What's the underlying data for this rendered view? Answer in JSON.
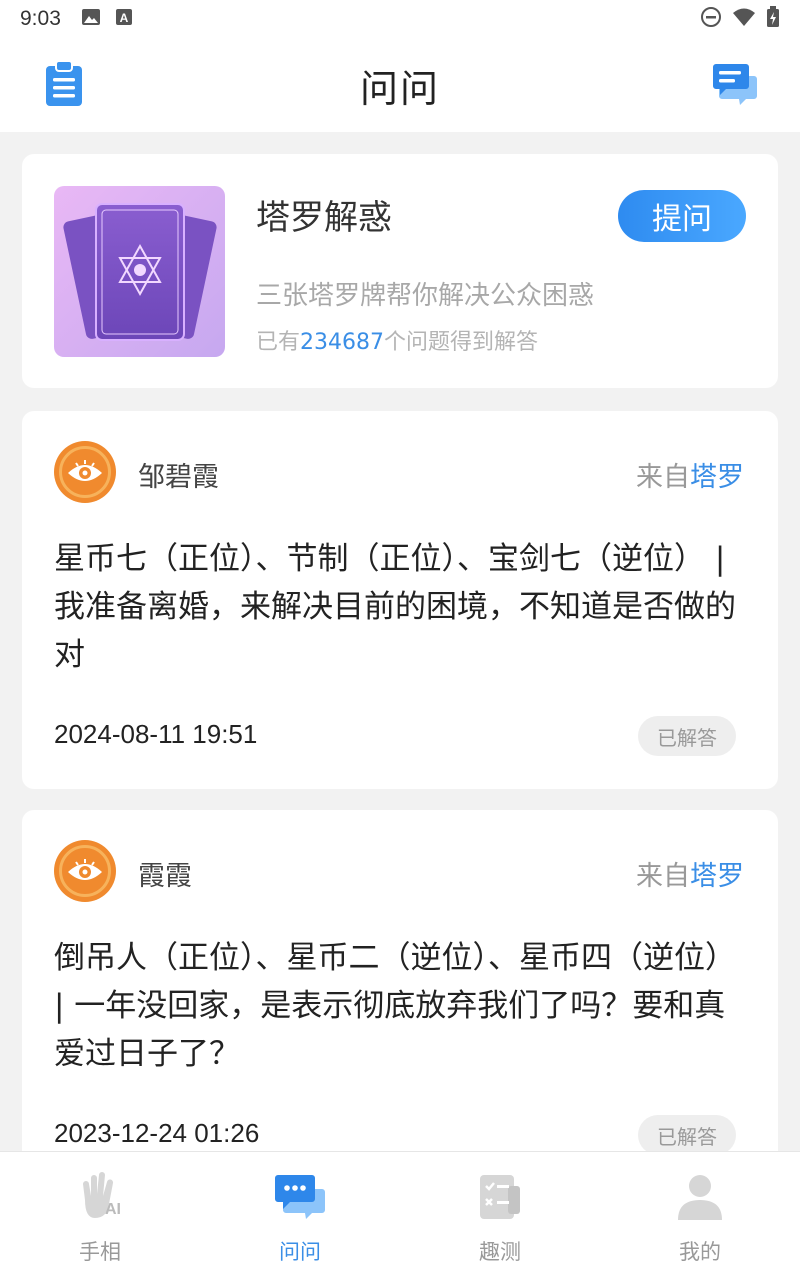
{
  "status_bar": {
    "time": "9:03",
    "left_icons": [
      "image-icon",
      "a-icon"
    ],
    "right_icons": [
      "dnd-icon",
      "wifi-icon",
      "battery-icon"
    ]
  },
  "header": {
    "title": "问问",
    "left_icon": "clipboard-icon",
    "right_icon": "chat-icon"
  },
  "tarot_card": {
    "title": "塔罗解惑",
    "ask_button": "提问",
    "description": "三张塔罗牌帮你解决公众困惑",
    "count_prefix": "已有",
    "count": "234687",
    "count_suffix": "个问题得到解答"
  },
  "questions": [
    {
      "user": "邹碧霞",
      "from_label": "来自",
      "source": "塔罗",
      "text": "星币七（正位）、节制（正位）、宝剑七（逆位） | 我准备离婚，来解决目前的困境，不知道是否做的对",
      "date": "2024-08-11 19:51",
      "status": "已解答"
    },
    {
      "user": "霞霞",
      "from_label": "来自",
      "source": "塔罗",
      "text": "倒吊人（正位）、星币二（逆位）、星币四（逆位） | 一年没回家，是表示彻底放弃我们了吗？要和真爱过日子了？",
      "date": "2023-12-24 01:26",
      "status": "已解答"
    }
  ],
  "tab_bar": {
    "tabs": [
      {
        "label": "手相",
        "icon": "palm-ai-icon"
      },
      {
        "label": "问问",
        "icon": "chat-icon"
      },
      {
        "label": "趣测",
        "icon": "test-sheet-icon"
      },
      {
        "label": "我的",
        "icon": "user-icon"
      }
    ],
    "active_tab": "问问"
  },
  "colors": {
    "accent": "#3a8ee6",
    "avatar": "#f08a2e",
    "background": "#f2f2f2"
  }
}
